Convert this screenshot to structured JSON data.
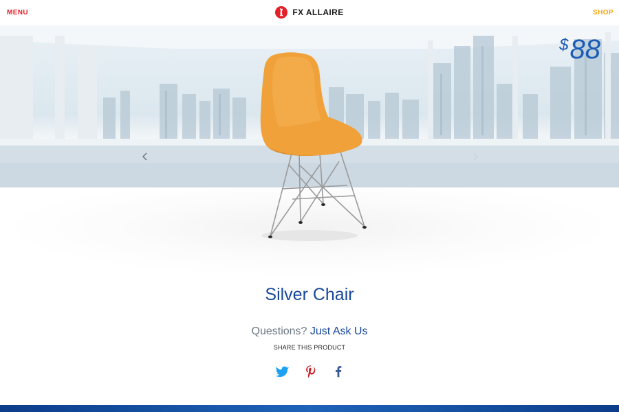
{
  "header": {
    "menu_label": "MENU",
    "brand_name": "FX ALLAIRE",
    "shop_label": "SHOP"
  },
  "product": {
    "price_currency": "$",
    "price_value": "88",
    "name": "Silver Chair"
  },
  "contact": {
    "question_text": "Questions?",
    "link_text": "Just Ask Us"
  },
  "share": {
    "label": "SHARE THIS PRODUCT",
    "networks": [
      "twitter-icon",
      "pinterest-icon",
      "facebook-icon"
    ]
  },
  "colors": {
    "menu": "#e4202a",
    "shop": "#f2a612",
    "brand_blue": "#18479b",
    "chair_orange": "#f0a13a",
    "twitter": "#1da1f2",
    "pinterest": "#cb2027",
    "facebook": "#3b5998"
  }
}
